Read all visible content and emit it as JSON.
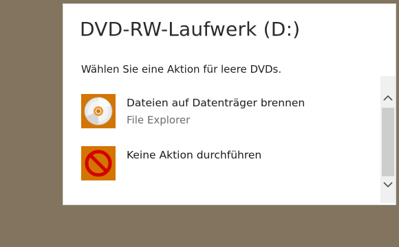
{
  "dialog": {
    "title": "DVD-RW-Laufwerk (D:)",
    "prompt": "Wählen Sie eine Aktion für leere DVDs.",
    "actions": [
      {
        "label": "Dateien auf Datenträger brennen",
        "sublabel": "File Explorer",
        "icon": "disc-burn-icon"
      },
      {
        "label": "Keine Aktion durchführen",
        "icon": "no-action-icon"
      }
    ]
  },
  "colors": {
    "desktop_background": "#82745f",
    "dialog_background": "#ffffff",
    "icon_tile": "#d37500",
    "no_action_red": "#d40000"
  }
}
